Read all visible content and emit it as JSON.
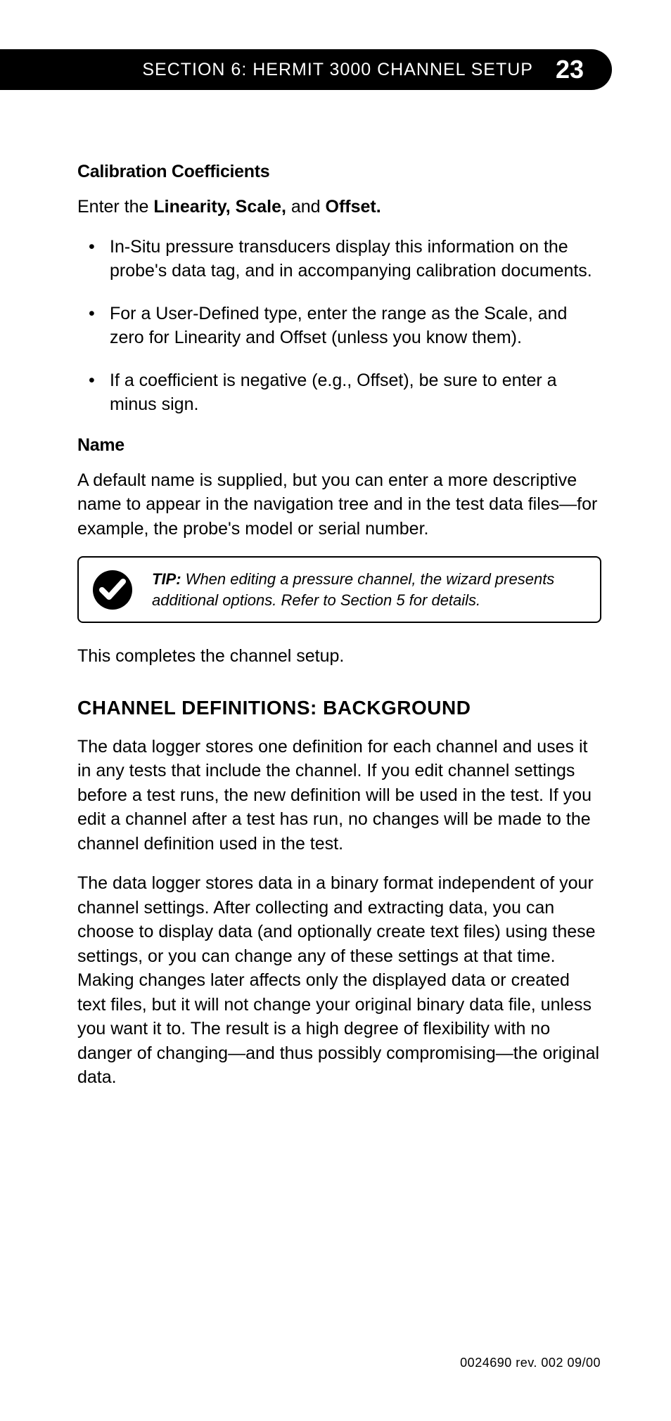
{
  "header": {
    "section_label": "SECTION 6: HERMIT 3000 CHANNEL SETUP",
    "page_number": "23"
  },
  "body": {
    "calib_heading": "Calibration Coefficients",
    "calib_intro_pre": "Enter the ",
    "calib_intro_bold1": "Linearity, Scale,",
    "calib_intro_mid": " and ",
    "calib_intro_bold2": "Offset.",
    "bullets": [
      "In-Situ pressure transducers display this information on the probe's data tag, and in accompanying calibration documents.",
      "For a User-Defined type, enter the range as the Scale, and zero for Linearity and Offset (unless you know them).",
      "If a coefficient is negative (e.g., Offset), be sure to enter a minus sign."
    ],
    "name_heading": "Name",
    "name_para": "A default name is supplied, but you can enter a more descriptive name to appear in the navigation tree and in the test data files—for example, the probe's model or serial number.",
    "tip_label": "TIP:",
    "tip_text": " When editing a pressure channel, the wizard presents additional options. Refer to Section 5 for details.",
    "complete_para": "This completes the channel setup.",
    "defs_heading": "CHANNEL DEFINITIONS: BACKGROUND",
    "defs_para1": "The data logger stores one definition for each channel and uses it in any tests that include the channel. If you edit channel settings before a test runs, the new definition will be used in the test. If you edit a channel after a test has run, no changes will be made to the channel definition used in the test.",
    "defs_para2": "The data logger stores data in a binary format independent of your channel settings. After collecting and extracting data, you can choose to display data (and optionally create text files) using these settings, or you can change any of these settings at that time. Making changes later affects only the displayed data or created text files, but it will not change your original binary data file, unless you want it to. The result is a high degree of flexibility with no danger of changing—and thus possibly compromising—the original data."
  },
  "footer": {
    "rev": "0024690  rev.  002    09/00"
  }
}
